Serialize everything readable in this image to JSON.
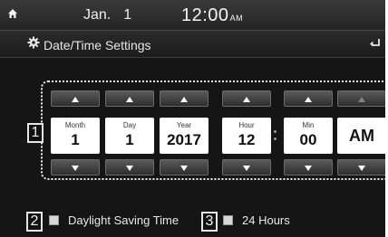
{
  "status_bar": {
    "month": "Jan.",
    "day": "1",
    "time": "12:00",
    "ampm": "AM"
  },
  "title_bar": {
    "title": "Date/Time Settings"
  },
  "callouts": [
    "1",
    "2",
    "3"
  ],
  "pickers": [
    {
      "label": "Month",
      "value": "1"
    },
    {
      "label": "Day",
      "value": "1"
    },
    {
      "label": "Year",
      "value": "2017"
    },
    {
      "label": "Hour",
      "value": "12"
    },
    {
      "label": "Min",
      "value": "00"
    },
    {
      "label": "",
      "value": "AM"
    }
  ],
  "options": {
    "daylight_saving": {
      "label": "Daylight Saving Time",
      "checked": false
    },
    "hours_24": {
      "label": "24 Hours",
      "checked": false
    }
  }
}
